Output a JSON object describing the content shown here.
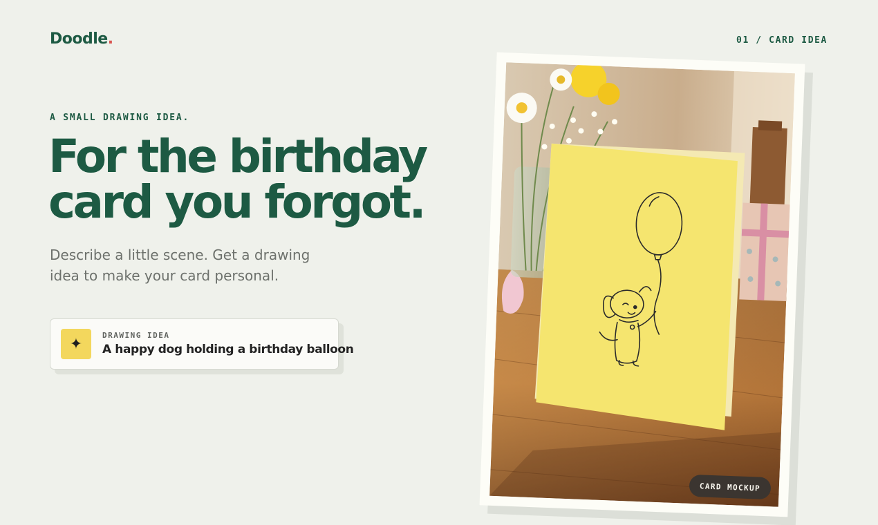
{
  "header": {
    "logo": "Doodle",
    "logo_dot": ".",
    "step": "01 / CARD IDEA"
  },
  "hero": {
    "kicker": "A SMALL DRAWING IDEA.",
    "headline_line1": "For the birthday",
    "headline_line2": "card you forgot.",
    "subtext": "Describe a little scene. Get a drawing idea to make your card personal."
  },
  "idea": {
    "icon": "sparkle-icon",
    "icon_glyph": "✦",
    "label": "DRAWING IDEA",
    "text": "A happy dog holding a birthday balloon"
  },
  "photo": {
    "badge": "CARD MOCKUP"
  },
  "colors": {
    "background": "#eff1eb",
    "brand_green": "#1d5a43",
    "accent_yellow": "#f3d75d",
    "logo_dot": "#d9534f"
  }
}
